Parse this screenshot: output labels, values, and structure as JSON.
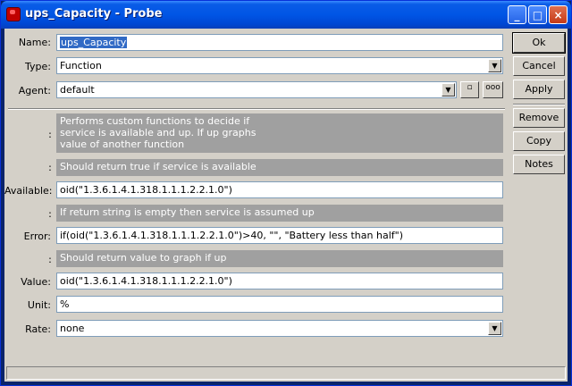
{
  "window": {
    "title": "ups_Capacity - Probe",
    "controls": {
      "minimize": "_",
      "maximize": "□",
      "close": "×"
    }
  },
  "form": {
    "name_label": "Name:",
    "name_value": "ups_Capacity",
    "type_label": "Type:",
    "type_value": "Function",
    "agent_label": "Agent:",
    "agent_value": "default",
    "desc_main": "Performs custom functions to decide if service is available and up. If up graphs value of another function",
    "desc_available": "Should return true if service is available",
    "available_label": "Available:",
    "available_value": "oid(\"1.3.6.1.4.1.318.1.1.1.2.2.1.0\")",
    "desc_error": "If return string is empty then service is assumed up",
    "error_label": "Error:",
    "error_value": "if(oid(\"1.3.6.1.4.1.318.1.1.1.2.2.1.0\")>40, \"\", \"Battery less than half\")",
    "desc_value": "Should return value to graph if up",
    "value_label": "Value:",
    "value_value": "oid(\"1.3.6.1.4.1.318.1.1.1.2.2.1.0\")",
    "unit_label": "Unit:",
    "unit_value": "%",
    "rate_label": "Rate:",
    "rate_value": "none",
    "colon": ":"
  },
  "buttons": {
    "ok": "Ok",
    "cancel": "Cancel",
    "apply": "Apply",
    "remove": "Remove",
    "copy": "Copy",
    "notes": "Notes"
  },
  "agent_buttons": {
    "small": "▫",
    "more": "ooo"
  },
  "colors": {
    "title_bar": "#0055e5",
    "client_bg": "#d4d0c8",
    "desc_bg": "#a0a0a0",
    "selection": "#316ac5"
  }
}
